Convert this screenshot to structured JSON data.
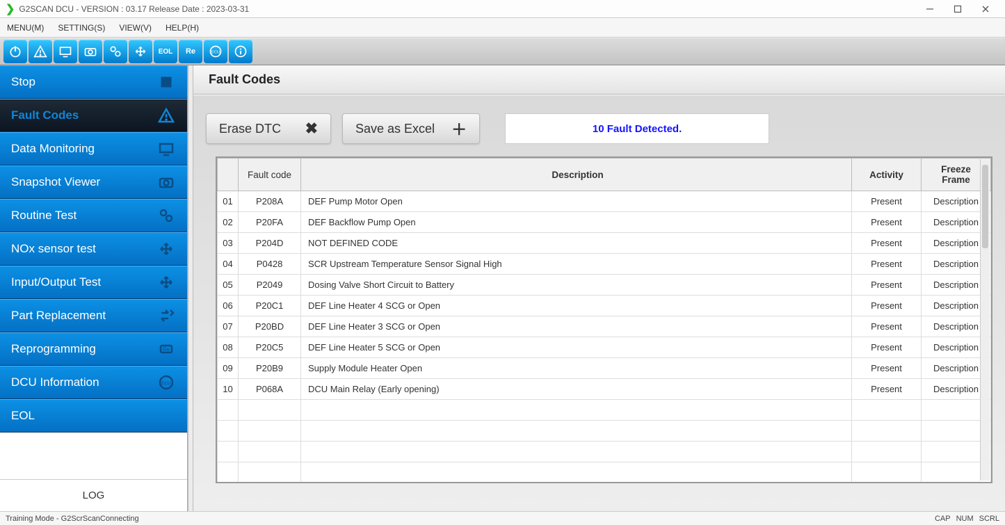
{
  "window": {
    "title": "G2SCAN DCU - VERSION : 03.17 Release Date : 2023-03-31"
  },
  "menubar": [
    "MENU(M)",
    "SETTING(S)",
    "VIEW(V)",
    "HELP(H)"
  ],
  "toolbar_icons": [
    "power",
    "warning",
    "monitor",
    "camera",
    "gears",
    "arrows",
    "eol",
    "re",
    "ecu",
    "info"
  ],
  "sidebar": {
    "items": [
      {
        "label": "Stop",
        "icon": "stop"
      },
      {
        "label": "Fault Codes",
        "icon": "warning",
        "active": true
      },
      {
        "label": "Data Monitoring",
        "icon": "monitor"
      },
      {
        "label": "Snapshot Viewer",
        "icon": "camera"
      },
      {
        "label": "Routine Test",
        "icon": "gears"
      },
      {
        "label": "NOx sensor test",
        "icon": "arrows"
      },
      {
        "label": "Input/Output Test",
        "icon": "arrows"
      },
      {
        "label": "Part Replacement",
        "icon": "swap"
      },
      {
        "label": "Reprogramming",
        "icon": "re"
      },
      {
        "label": "DCU Information",
        "icon": "ecu"
      },
      {
        "label": "EOL",
        "icon": ""
      }
    ],
    "log_label": "LOG"
  },
  "page": {
    "title": "Fault Codes",
    "erase_label": "Erase DTC",
    "save_label": "Save as Excel",
    "banner": "10 Fault Detected."
  },
  "table": {
    "headers": [
      "",
      "Fault code",
      "Description",
      "Activity",
      "Freeze Frame"
    ],
    "rows": [
      {
        "idx": "01",
        "code": "P208A",
        "desc": "DEF Pump Motor Open",
        "activity": "Present",
        "ff": "Description"
      },
      {
        "idx": "02",
        "code": "P20FA",
        "desc": "DEF Backflow Pump Open",
        "activity": "Present",
        "ff": "Description"
      },
      {
        "idx": "03",
        "code": "P204D",
        "desc": "NOT DEFINED CODE",
        "activity": "Present",
        "ff": "Description"
      },
      {
        "idx": "04",
        "code": "P0428",
        "desc": "SCR Upstream Temperature Sensor Signal High",
        "activity": "Present",
        "ff": "Description"
      },
      {
        "idx": "05",
        "code": "P2049",
        "desc": "Dosing Valve Short Circuit to Battery",
        "activity": "Present",
        "ff": "Description"
      },
      {
        "idx": "06",
        "code": "P20C1",
        "desc": "DEF Line Heater 4 SCG or Open",
        "activity": "Present",
        "ff": "Description"
      },
      {
        "idx": "07",
        "code": "P20BD",
        "desc": "DEF Line Heater 3 SCG or Open",
        "activity": "Present",
        "ff": "Description"
      },
      {
        "idx": "08",
        "code": "P20C5",
        "desc": "DEF Line Heater 5 SCG or Open",
        "activity": "Present",
        "ff": "Description"
      },
      {
        "idx": "09",
        "code": "P20B9",
        "desc": "Supply Module Heater Open",
        "activity": "Present",
        "ff": "Description"
      },
      {
        "idx": "10",
        "code": "P068A",
        "desc": "DCU Main Relay (Early opening)",
        "activity": "Present",
        "ff": "Description"
      }
    ],
    "empty_rows": 4
  },
  "statusbar": {
    "left": "Training Mode - G2ScrScanConnecting",
    "cap": "CAP",
    "num": "NUM",
    "scrl": "SCRL"
  }
}
